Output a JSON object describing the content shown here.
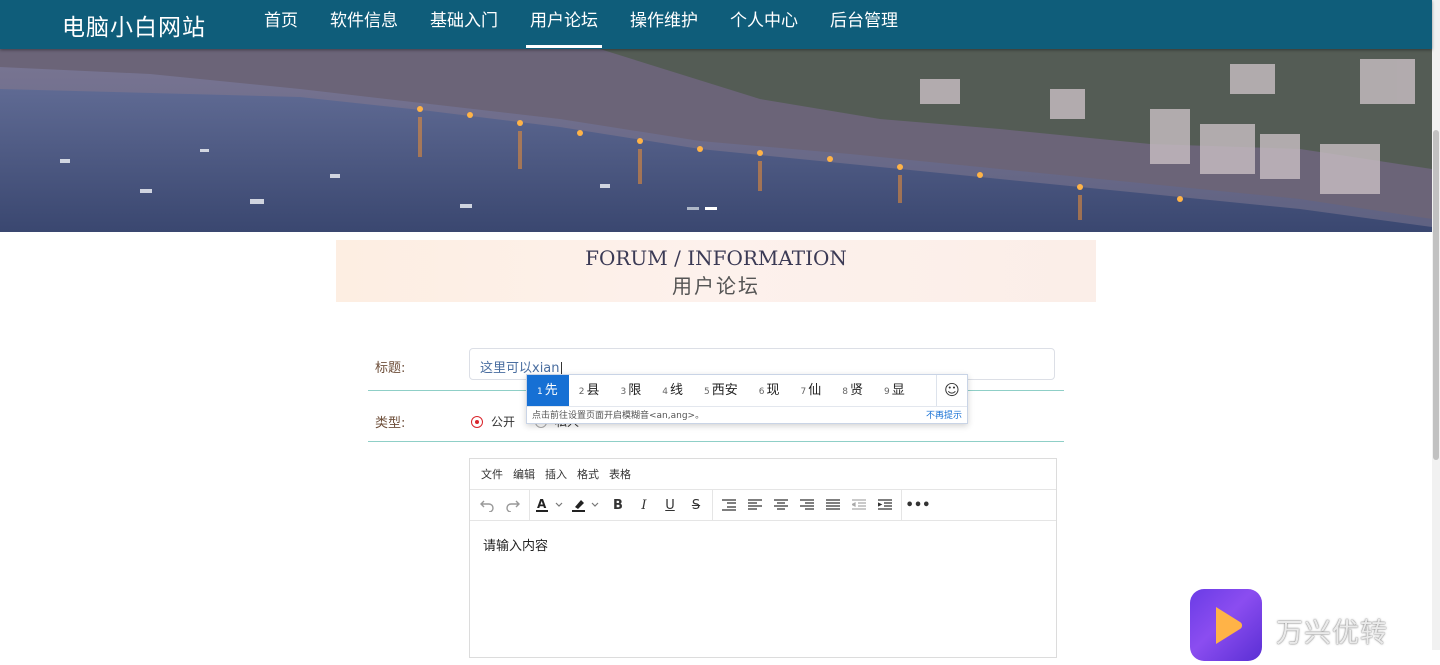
{
  "site": {
    "title": "电脑小白网站"
  },
  "nav": {
    "items": [
      {
        "label": "首页",
        "active": false
      },
      {
        "label": "软件信息",
        "active": false
      },
      {
        "label": "基础入门",
        "active": false
      },
      {
        "label": "用户论坛",
        "active": true
      },
      {
        "label": "操作维护",
        "active": false
      },
      {
        "label": "个人中心",
        "active": false
      },
      {
        "label": "后台管理",
        "active": false
      }
    ]
  },
  "banner": {
    "active_slide": 2,
    "slide_count": 2
  },
  "section": {
    "title_en": "FORUM / INFORMATION",
    "title_cn": "用户论坛"
  },
  "form": {
    "title_label": "标题:",
    "title_value": "这里可以xian",
    "type_label": "类型:",
    "type_options": [
      {
        "label": "公开",
        "checked": true
      },
      {
        "label": "私人",
        "checked": false
      }
    ]
  },
  "ime": {
    "candidates": [
      {
        "num": "1",
        "text": "先"
      },
      {
        "num": "2",
        "text": "县"
      },
      {
        "num": "3",
        "text": "限"
      },
      {
        "num": "4",
        "text": "线"
      },
      {
        "num": "5",
        "text": "西安"
      },
      {
        "num": "6",
        "text": "现"
      },
      {
        "num": "7",
        "text": "仙"
      },
      {
        "num": "8",
        "text": "贤"
      },
      {
        "num": "9",
        "text": "显"
      }
    ],
    "tip": "点击前往设置页面开启模糊音<an,ang>。",
    "dismiss": "不再提示",
    "emoji": "☺"
  },
  "editor": {
    "menus": [
      "文件",
      "编辑",
      "插入",
      "格式",
      "表格"
    ],
    "placeholder": "请输入内容"
  },
  "watermark": {
    "text": "万兴优转"
  },
  "colors": {
    "nav_bg": "#0f5d7a",
    "ime_selected": "#1670d4",
    "radio_checked": "#d9252b"
  }
}
